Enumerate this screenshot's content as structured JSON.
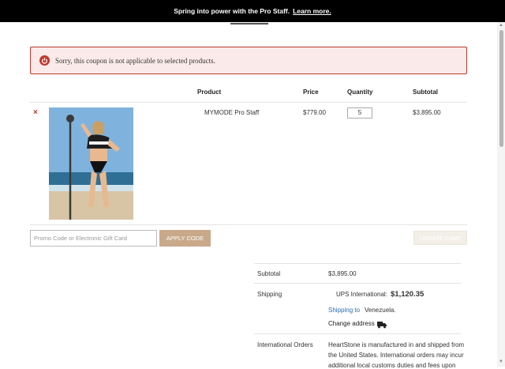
{
  "banner": {
    "text": "Spring into power with the Pro Staff.",
    "link": "Learn more."
  },
  "alert": {
    "message": "Sorry, this coupon is not applicable to selected products."
  },
  "cart": {
    "headers": {
      "product": "Product",
      "price": "Price",
      "quantity": "Quantity",
      "subtotal": "Subtotal"
    },
    "item": {
      "remove": "×",
      "name": "MYMODE Pro Staff",
      "price": "$779.00",
      "quantity": "5",
      "subtotal": "$3,895.00"
    }
  },
  "coupon": {
    "placeholder": "Promo Code or Electronic Gift Card",
    "apply": "APPLY CODE",
    "update": "UPDATE CART"
  },
  "totals": {
    "subtotal_label": "Subtotal",
    "subtotal_value": "$3,895.00",
    "shipping_label": "Shipping",
    "shipping_method": "UPS International:",
    "shipping_cost": "$1,120.35",
    "shipping_to_prefix": "Shipping to",
    "shipping_country": "Venezuela.",
    "change_address": "Change address",
    "intl_label": "International Orders",
    "intl_line1": "HeartStone is manufactured in and shipped from",
    "intl_line2": "the United States. International orders may incur",
    "intl_line3": "additional local customs duties and fees upon"
  },
  "colors": {
    "alert_border": "#c0392b",
    "alert_bg": "#fbeaea",
    "apply_bg": "#c9a98a",
    "link_blue": "#2a6db0"
  }
}
